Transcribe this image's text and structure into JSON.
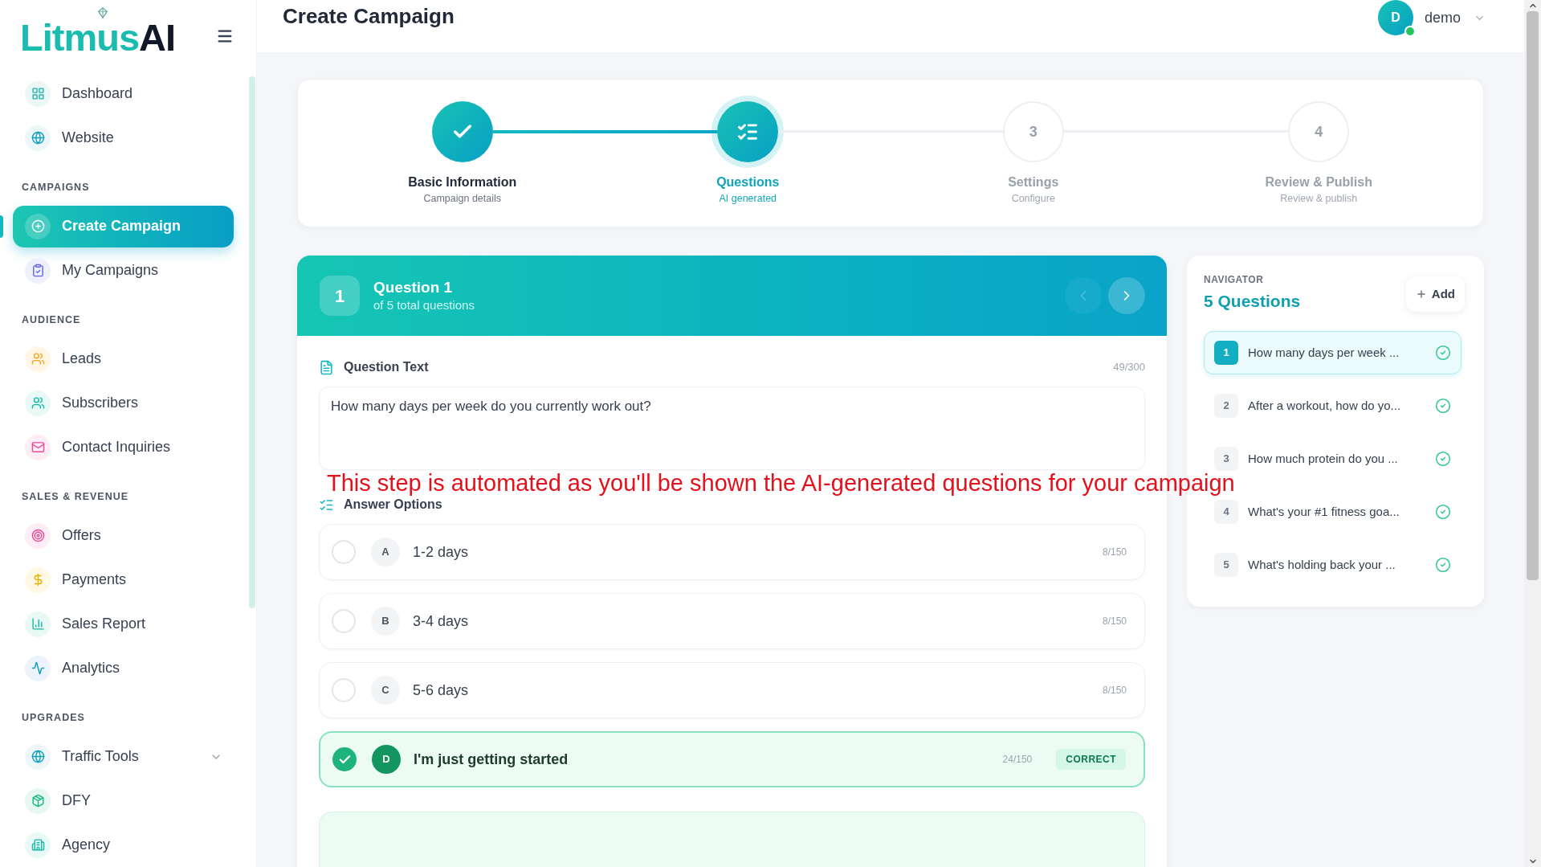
{
  "sidebar": {
    "logo": {
      "text": "Litmus",
      "accent": "AI"
    },
    "sections": [
      {
        "items": [
          {
            "label": "Dashboard",
            "selected": false
          },
          {
            "label": "Website",
            "selected": false
          }
        ]
      },
      {
        "heading": "CAMPAIGNS",
        "items": [
          {
            "label": "Create Campaign",
            "selected": true
          },
          {
            "label": "My Campaigns",
            "selected": false
          }
        ]
      },
      {
        "heading": "AUDIENCE",
        "items": [
          {
            "label": "Leads",
            "selected": false
          },
          {
            "label": "Subscribers",
            "selected": false
          },
          {
            "label": "Contact Inquiries",
            "selected": false
          }
        ]
      },
      {
        "heading": "SALES & REVENUE",
        "items": [
          {
            "label": "Offers",
            "selected": false
          },
          {
            "label": "Payments",
            "selected": false
          },
          {
            "label": "Sales Report",
            "selected": false
          },
          {
            "label": "Analytics",
            "selected": false
          }
        ]
      },
      {
        "heading": "UPGRADES",
        "items": [
          {
            "label": "Traffic Tools",
            "selected": false,
            "expanded": false
          },
          {
            "label": "DFY",
            "selected": false
          },
          {
            "label": "Agency",
            "selected": false
          }
        ]
      }
    ]
  },
  "header": {
    "title": "Create Campaign",
    "user": {
      "initial": "D",
      "name": "demo",
      "online": true
    }
  },
  "steps": [
    {
      "label": "Basic Information",
      "sublabel": "Campaign details",
      "done": true,
      "current": false
    },
    {
      "label": "Questions",
      "sublabel": "AI generated",
      "done": false,
      "current": true
    },
    {
      "label": "Settings",
      "sublabel": "Configure",
      "done": false,
      "current": false,
      "number": "3"
    },
    {
      "label": "Review & Publish",
      "sublabel": "Review & publish",
      "done": false,
      "current": false,
      "number": "4"
    }
  ],
  "question": {
    "number": "1",
    "title": "Question 1",
    "subtitle": "of 5 total questions",
    "prev_disabled": true,
    "next_disabled": false,
    "text_field": {
      "label": "Question Text",
      "counter": "49/300",
      "value": "How many days per week do you currently work out?"
    },
    "answers": {
      "label": "Answer Options",
      "options": [
        {
          "letter": "A",
          "text": "1-2 days",
          "counter": "8/150",
          "correct": false
        },
        {
          "letter": "B",
          "text": "3-4 days",
          "counter": "8/150",
          "correct": false
        },
        {
          "letter": "C",
          "text": "5-6 days",
          "counter": "8/150",
          "correct": false
        },
        {
          "letter": "D",
          "text": "I'm just getting started",
          "counter": "24/150",
          "correct": true,
          "badge": "CORRECT"
        }
      ]
    }
  },
  "caption": "This step is automated as you'll be shown the AI-generated questions for your campaign",
  "navigator": {
    "label": "NAVIGATOR",
    "title": "5 Questions",
    "add_button": "Add",
    "items": [
      {
        "number": "1",
        "text": "How many days per week ...",
        "selected": true,
        "complete": true
      },
      {
        "number": "2",
        "text": "After a workout, how do yo...",
        "selected": false,
        "complete": true
      },
      {
        "number": "3",
        "text": "How much protein do you ...",
        "selected": false,
        "complete": true
      },
      {
        "number": "4",
        "text": "What's your #1 fitness goa...",
        "selected": false,
        "complete": true
      },
      {
        "number": "5",
        "text": "What's holding back your ...",
        "selected": false,
        "complete": true
      }
    ]
  }
}
